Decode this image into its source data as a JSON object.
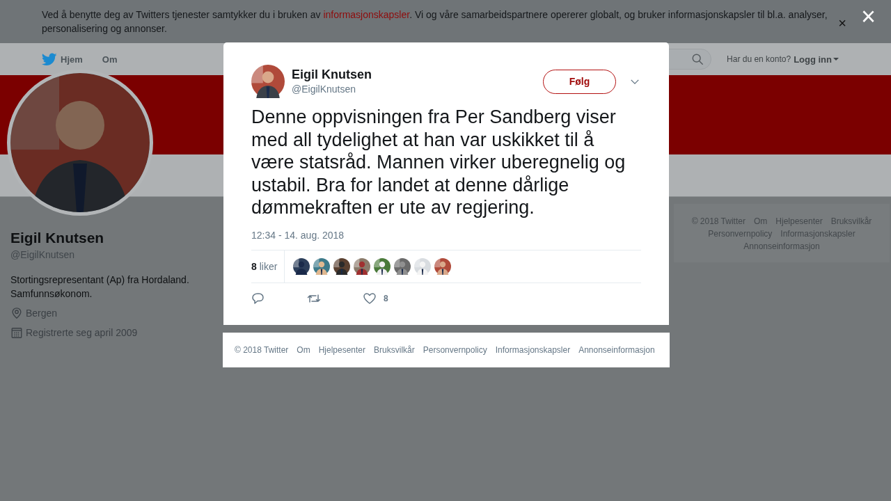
{
  "cookie_banner": {
    "text_before": "Ved å benytte deg av Twitters tjenester samtykker du i bruken av ",
    "link": "informasjonskapsler",
    "text_after": ". Vi og våre samarbeidspartnere opererer globalt, og bruker informasjonskapsler til bl.a. analyser, personalisering og annonser.",
    "close": "×"
  },
  "nav": {
    "items": [
      {
        "label": "Hjem",
        "kind": "home"
      },
      {
        "label": "Om",
        "kind": "plain"
      }
    ],
    "login_prompt": "Har du en konto?",
    "login_link": "Logg inn"
  },
  "profile": {
    "name": "Eigil Knutsen",
    "handle": "@EigilKnutsen",
    "bio": "Stortingsrepresentant (Ap) fra Hordaland. Samfunnsøkonom.",
    "location": "Bergen",
    "joined": "Registrerte seg april 2009"
  },
  "side_footer": [
    "© 2018 Twitter",
    "Om",
    "Hjelpesenter",
    "Bruksvilkår",
    "Personvernpolicy",
    "Informasjonskapsler",
    "Annonseinformasjon"
  ],
  "modal": {
    "close": "×",
    "tweet": {
      "author": "Eigil Knutsen",
      "handle": "@EigilKnutsen",
      "follow": "Følg",
      "text": "Denne oppvisningen fra Per Sandberg viser med all tydelighet at han var uskikket til å være statsråd. Mannen virker uberegnelig og ustabil. Bra for landet at denne dårlige dømmekraften er ute av regjering.",
      "time": "12:34 - 14. aug. 2018",
      "likes_count": "8",
      "likes_label": "liker",
      "actions": [
        {
          "kind": "reply"
        },
        {
          "kind": "retweet"
        },
        {
          "kind": "like",
          "count": "8"
        }
      ]
    },
    "footer": [
      "© 2018 Twitter",
      "Om",
      "Hjelpesenter",
      "Bruksvilkår",
      "Personvernpolicy",
      "Informasjonskapsler",
      "Annonseinformasjon"
    ]
  }
}
